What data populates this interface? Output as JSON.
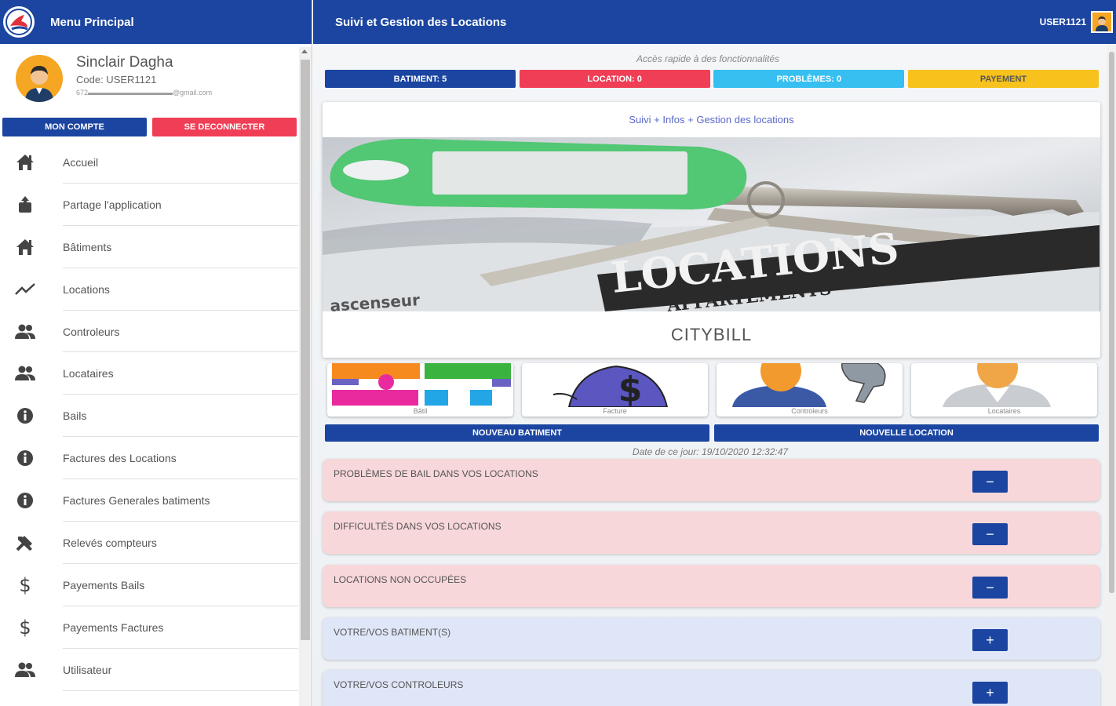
{
  "sidebar": {
    "title": "Menu Principal",
    "profile": {
      "name": "Sinclair Dagha",
      "code": "Code: USER1121",
      "email": "672▬▬▬▬▬▬▬▬▬▬▬▬@gmail.com"
    },
    "buttons": {
      "account": "MON COMPTE",
      "logout": "SE DECONNECTER"
    },
    "items": [
      {
        "label": "Accueil",
        "icon": "home-icon"
      },
      {
        "label": "Partage l'application",
        "icon": "share-icon"
      },
      {
        "label": "Bâtiments",
        "icon": "building-icon"
      },
      {
        "label": "Locations",
        "icon": "trending-icon"
      },
      {
        "label": "Controleurs",
        "icon": "people-icon"
      },
      {
        "label": "Locataires",
        "icon": "people-icon"
      },
      {
        "label": "Bails",
        "icon": "info-icon"
      },
      {
        "label": "Factures des Locations",
        "icon": "info-icon"
      },
      {
        "label": "Factures Generales batiments",
        "icon": "info-icon"
      },
      {
        "label": "Relevés compteurs",
        "icon": "tools-icon"
      },
      {
        "label": "Payements Bails",
        "icon": "dollar-icon"
      },
      {
        "label": "Payements Factures",
        "icon": "dollar-icon"
      },
      {
        "label": "Utilisateur",
        "icon": "people-icon"
      }
    ]
  },
  "header": {
    "title": "Suivi et Gestion des Locations",
    "user": "USER1121"
  },
  "quick_access": {
    "caption": "Accès rapide à des fonctionnalités",
    "tiles": [
      {
        "label": "BATIMENT: 5",
        "color": "#1b45a0"
      },
      {
        "label": "LOCATION: 0",
        "color": "#ef3e56"
      },
      {
        "label": "PROBLÈMES: 0",
        "color": "#36bff0"
      },
      {
        "label": "PAYEMENT",
        "color": "#f7c21c"
      }
    ]
  },
  "hero": {
    "subtitle": "Suivi + Infos + Gestion des locations",
    "image_text_main": "LOCATIONS",
    "image_text_sub": "APPARTEMENTS",
    "image_text_side": "ascenseur",
    "name": "CITYBILL"
  },
  "shortcuts": [
    {
      "label": "Bâtil"
    },
    {
      "label": "Facture"
    },
    {
      "label": "Controleurs"
    },
    {
      "label": "Locataires"
    }
  ],
  "actions": {
    "new_building": "NOUVEAU BATIMENT",
    "new_location": "NOUVELLE LOCATION"
  },
  "date_line": "Date de ce jour: 19/10/2020 12:32:47",
  "panels": [
    {
      "label": "PROBLÈMES DE BAIL DANS VOS LOCATIONS",
      "state": "−",
      "tone": "red"
    },
    {
      "label": "DIFFICULTÉS DANS VOS LOCATIONS",
      "state": "−",
      "tone": "red"
    },
    {
      "label": "LOCATIONS NON OCCUPÉES",
      "state": "−",
      "tone": "red"
    },
    {
      "label": "VOTRE/VOS BATIMENT(S)",
      "state": "+",
      "tone": "blue"
    },
    {
      "label": "VOTRE/VOS CONTROLEURS",
      "state": "+",
      "tone": "blue"
    }
  ]
}
